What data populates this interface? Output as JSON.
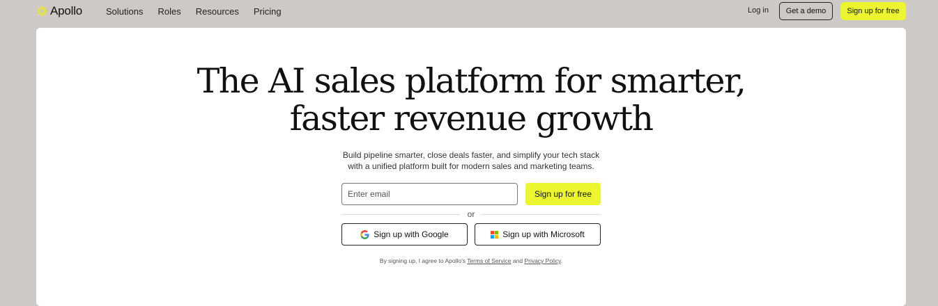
{
  "nav": {
    "logo_text": "Apollo",
    "logo_icon": "apollo-burst-logo-icon",
    "links": [
      "Solutions",
      "Roles",
      "Resources",
      "Pricing"
    ],
    "login": "Log in",
    "demo": "Get a demo",
    "signup": "Sign up for free"
  },
  "hero": {
    "headline_line1": "The AI sales platform for smarter,",
    "headline_line2": "faster revenue growth",
    "sub_line1": "Build pipeline smarter, close deals faster, and simplify your tech stack",
    "sub_line2": "with a unified platform built for modern sales and marketing teams.",
    "email_placeholder": "Enter email",
    "email_value": "",
    "signup_button": "Sign up for free",
    "or_text": "or",
    "google_button": "Sign up with Google",
    "google_icon": "google-g-icon",
    "microsoft_button": "Sign up with Microsoft",
    "microsoft_icon": "microsoft-logo-icon"
  },
  "legal": {
    "prefix": "By signing up, I agree to Apollo's",
    "terms": "Terms of Service",
    "and": "and",
    "privacy": "Privacy Policy",
    "suffix": "."
  },
  "colors": {
    "page_bg": "#cdc9c6",
    "card_bg": "#ffffff",
    "accent_yellow": "#ebf530",
    "text": "#111111",
    "microsoft_red": "#f25022",
    "microsoft_green": "#7fba00",
    "microsoft_blue": "#00a4ef",
    "microsoft_yellow": "#ffb900"
  }
}
